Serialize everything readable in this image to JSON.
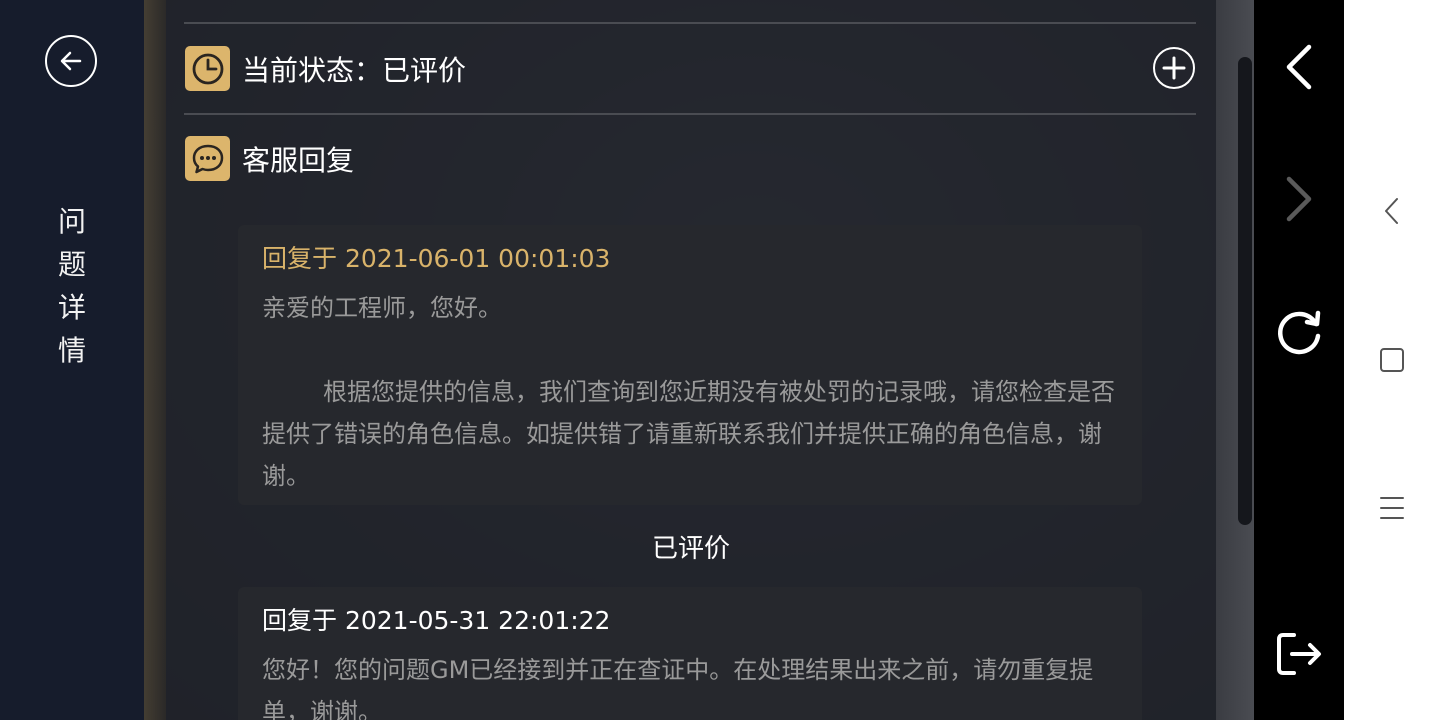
{
  "left_panel": {
    "title": "问题详情"
  },
  "status_row": {
    "label": "当前状态：已评价"
  },
  "reply_section": {
    "title": "客服回复"
  },
  "replies": [
    {
      "time": "回复于 2021-06-01 00:01:03",
      "body": "亲爱的工程师，您好。\n\n        根据您提供的信息，我们查询到您近期没有被处罚的记录哦，请您检查是否提供了错误的角色信息。如提供错了请重新联系我们并提供正确的角色信息，谢谢。"
    },
    {
      "time": "回复于 2021-05-31 22:01:22",
      "body": "您好！您的问题GM已经接到并正在查证中。在处理结果出来之前，请勿重复提单，谢谢。"
    }
  ],
  "rated_label": "已评价",
  "colors": {
    "accent_gold": "#dcb56c",
    "reply_time_gold": "#d9b36a",
    "body_gray": "#9a9a9a"
  },
  "icons": {
    "back": "back-circle-icon",
    "clock": "clock-icon",
    "chat": "chat-bubble-icon",
    "add": "add-circle-icon",
    "nav_back": "chevron-left-icon",
    "nav_forward": "chevron-right-icon",
    "refresh": "refresh-icon",
    "exit": "exit-icon",
    "sys_back": "system-back-icon",
    "sys_home": "system-home-icon",
    "sys_menu": "system-menu-icon"
  }
}
